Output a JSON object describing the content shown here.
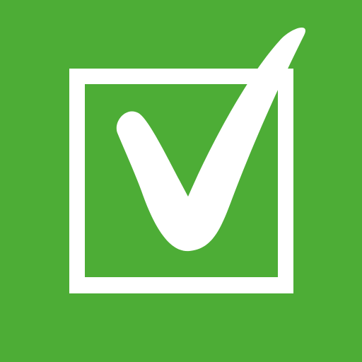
{
  "icon": {
    "name": "checked-checkbox-icon",
    "background_color": "#4dad36",
    "foreground_color": "#ffffff",
    "state": "checked"
  }
}
